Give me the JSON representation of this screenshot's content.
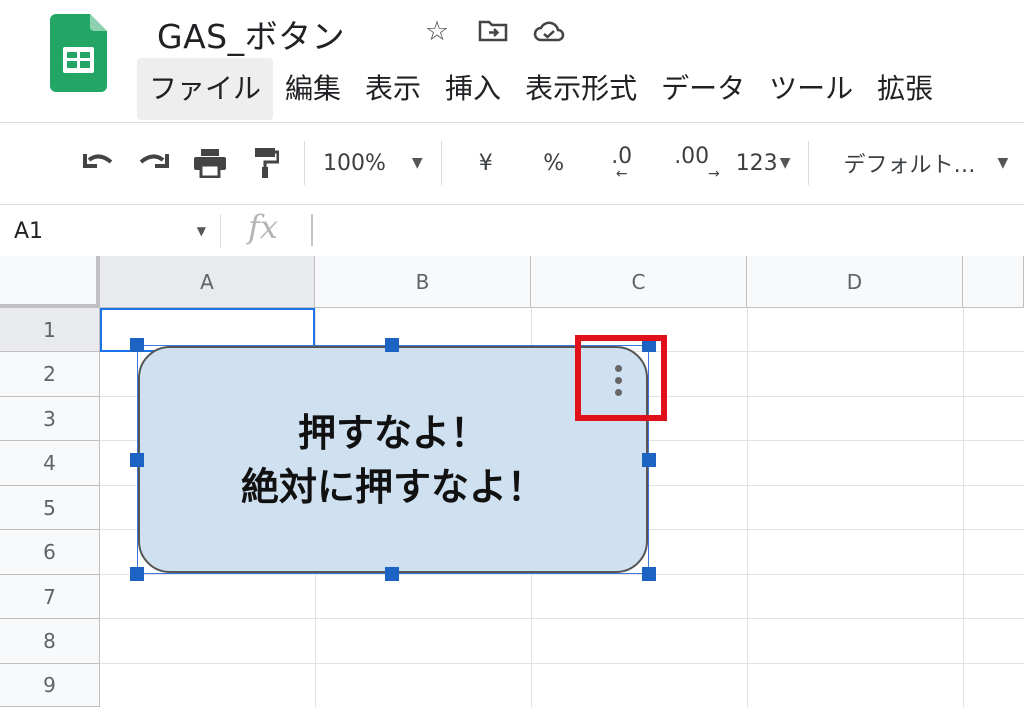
{
  "app": {
    "doc_title": "GAS_ボタン",
    "logo_icon": "google-sheets-icon",
    "title_icons": [
      "star-icon",
      "move-to-folder-icon",
      "cloud-saved-icon"
    ],
    "accent_color": "#1a73e8",
    "logo_color": "#23a566"
  },
  "menu": [
    {
      "label": "ファイル",
      "active": true
    },
    {
      "label": "編集"
    },
    {
      "label": "表示"
    },
    {
      "label": "挿入"
    },
    {
      "label": "表示形式"
    },
    {
      "label": "データ"
    },
    {
      "label": "ツール"
    },
    {
      "label": "拡張"
    }
  ],
  "toolbar": {
    "zoom": "100%",
    "currency": "¥",
    "percent": "%",
    "decrease_decimal": ".0",
    "increase_decimal": ".00",
    "more_formats": "123",
    "font": "デフォルト…",
    "icons": [
      "undo-icon",
      "redo-icon",
      "print-icon",
      "paint-format-icon"
    ]
  },
  "formula_bar": {
    "cell_ref": "A1",
    "fx_label": "fx",
    "value": ""
  },
  "sheet": {
    "columns": [
      "A",
      "B",
      "C",
      "D"
    ],
    "rows": [
      "1",
      "2",
      "3",
      "4",
      "5",
      "6",
      "7",
      "8",
      "9"
    ],
    "selected_cell": "A1"
  },
  "drawing": {
    "line1": "押すなよ！",
    "line2": "絶対に押すなよ！",
    "fill_color": "#cfe0f1",
    "highlight_color": "#e0111b",
    "menu_icon": "more-vert-icon"
  }
}
